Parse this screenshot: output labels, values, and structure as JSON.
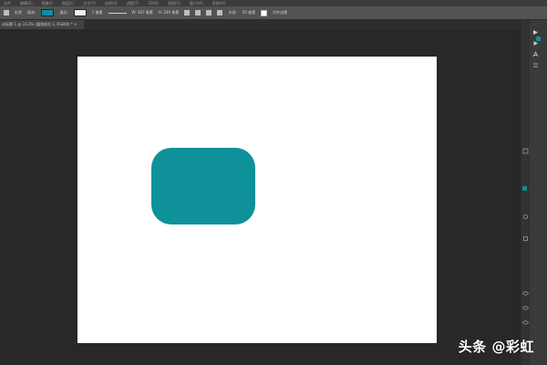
{
  "menubar": {
    "items": [
      "文件",
      "编辑(E)",
      "图像(I)",
      "图层(L)",
      "文字(Y)",
      "选择(S)",
      "滤镜(T)",
      "3D(D)",
      "视图(V)",
      "窗口(W)",
      "帮助(H)"
    ]
  },
  "options": {
    "shape_mode": "形状",
    "fill_label": "填充:",
    "stroke_label": "描边:",
    "stroke_size": "1 像素",
    "width_label": "W: 367 像素",
    "height_label": "H: 249 像素",
    "align_edges": "对齐边缘",
    "radius_label": "半径:",
    "radius_value": "50 像素"
  },
  "document": {
    "tab_title": "未标题-1 @ 33.3% (圆角矩形 1, RGB/8) * ×"
  },
  "canvas": {
    "shape_color": "#0e9198",
    "background_color": "#ffffff"
  },
  "panel": {
    "accent_color": "#0e9198"
  },
  "watermark": "头条 @彩虹"
}
